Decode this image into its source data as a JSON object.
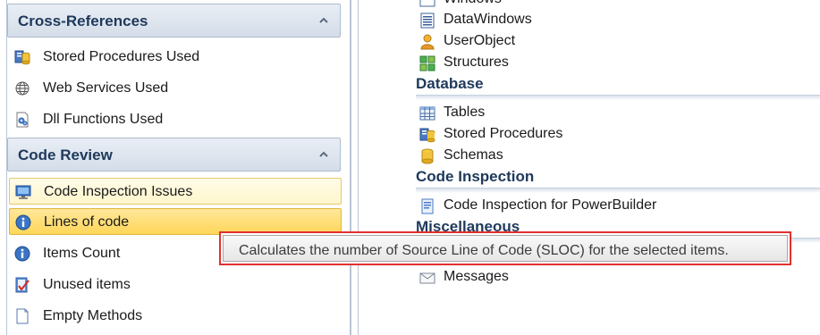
{
  "left_panel": {
    "cross_references": {
      "title": "Cross-References",
      "collapse_icon": "chevron-up-icon",
      "items": [
        {
          "label": "Stored Procedures Used",
          "icon": "stored-procedure-icon"
        },
        {
          "label": "Web Services Used",
          "icon": "web-service-icon"
        },
        {
          "label": "Dll Functions Used",
          "icon": "dll-icon"
        }
      ]
    },
    "code_review": {
      "title": "Code Review",
      "collapse_icon": "chevron-up-icon",
      "items": [
        {
          "label": "Code Inspection Issues",
          "icon": "monitor-icon",
          "state": "hover"
        },
        {
          "label": "Lines of code",
          "icon": "info-icon",
          "state": "selected"
        },
        {
          "label": "Items Count",
          "icon": "info-icon"
        },
        {
          "label": "Unused items",
          "icon": "checklist-icon"
        },
        {
          "label": "Empty Methods",
          "icon": "document-icon"
        }
      ]
    }
  },
  "right_panel": {
    "top_items": [
      {
        "label": "Windows",
        "icon": "window-icon"
      },
      {
        "label": "DataWindows",
        "icon": "datawindow-icon"
      },
      {
        "label": "UserObject",
        "icon": "userobject-icon"
      },
      {
        "label": "Structures",
        "icon": "structure-icon"
      }
    ],
    "database": {
      "title": "Database",
      "items": [
        {
          "label": "Tables",
          "icon": "table-icon"
        },
        {
          "label": "Stored Procedures",
          "icon": "stored-procedure-icon"
        },
        {
          "label": "Schemas",
          "icon": "schema-icon"
        }
      ]
    },
    "code_inspection": {
      "title": "Code Inspection",
      "items": [
        {
          "label": "Code Inspection for PowerBuilder",
          "icon": "code-inspection-icon"
        }
      ]
    },
    "miscellaneous": {
      "title": "Miscellaneous",
      "items": [
        {
          "label": "Messages",
          "icon": "envelope-icon"
        }
      ]
    }
  },
  "tooltip": {
    "text": "Calculates the number of Source Line of Code (SLOC) for the selected items."
  },
  "colors": {
    "group_header_title": "#1e395b",
    "selected_fill": "#ffd659",
    "tooltip_border": "#e03030"
  }
}
